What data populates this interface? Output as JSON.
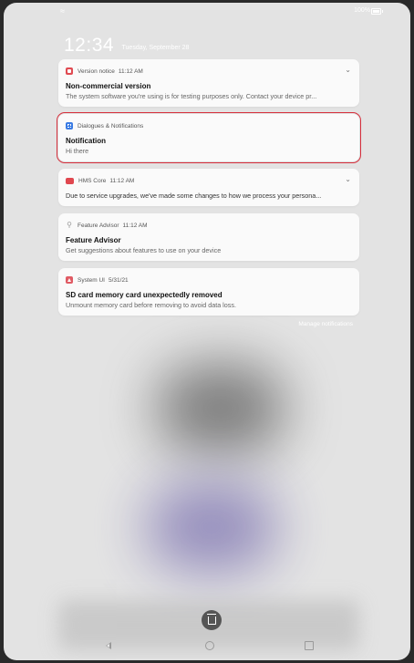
{
  "status_bar": {
    "battery_text": "100%"
  },
  "lock_clock": {
    "time": "12:34",
    "date": "Tuesday, September 28"
  },
  "notifications": [
    {
      "app": "Version notice",
      "time": "11:12 AM",
      "title": "Non-commercial version",
      "body": "The system software you're using is for testing purposes only. Contact your device pr..."
    },
    {
      "app": "Dialogues & Notifications",
      "time": "",
      "title": "Notification",
      "body": "Hi there"
    },
    {
      "app": "HMS Core",
      "time": "11:12 AM",
      "title": "",
      "body": "Due to service upgrades, we've made some changes to how we process your persona..."
    },
    {
      "app": "Feature Advisor",
      "time": "11:12 AM",
      "title": "Feature Advisor",
      "body": "Get suggestions about features to use on your device"
    },
    {
      "app": "System UI",
      "time": "5/31/21",
      "title": "SD card memory card unexpectedly removed",
      "body": "Unmount memory card before removing to avoid data loss."
    }
  ],
  "manage_label": "Manage notifications",
  "accent": {
    "highlight": "#d62f3c"
  }
}
